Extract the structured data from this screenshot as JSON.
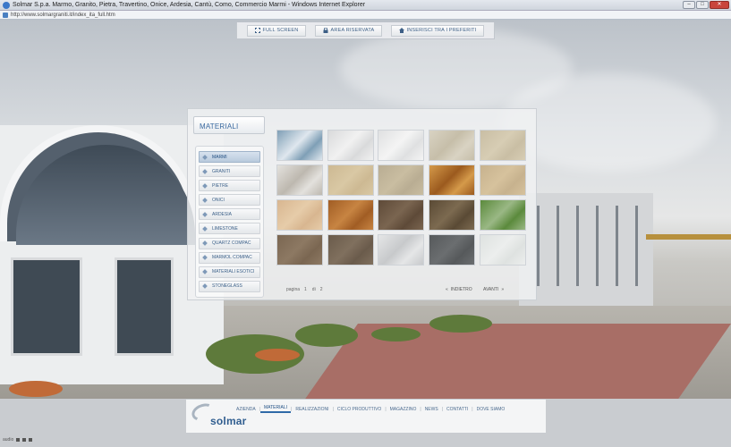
{
  "window": {
    "title": "Solmar S.p.a. Marmo, Granito, Pietra, Travertino, Onice, Ardesia, Cantù, Como, Commercio Marmi - Windows Internet Explorer",
    "url": "http://www.solmargraniti.it/index_ita_full.htm"
  },
  "toolbar": {
    "buttons": [
      {
        "label": "FULL SCREEN",
        "icon": "fullscreen-icon"
      },
      {
        "label": "AREA RISERVATA",
        "icon": "lock-icon"
      },
      {
        "label": "INSERISCI TRA I PREFERITI",
        "icon": "home-icon"
      }
    ]
  },
  "materials": {
    "title": "MATERIALI",
    "menu": [
      {
        "label": "MARMI",
        "active": true
      },
      {
        "label": "GRANITI",
        "active": false
      },
      {
        "label": "PIETRE",
        "active": false
      },
      {
        "label": "ONICI",
        "active": false
      },
      {
        "label": "ARDESIA",
        "active": false
      },
      {
        "label": "LIMESTONE",
        "active": false
      },
      {
        "label": "QUARTZ COMPAC",
        "active": false
      },
      {
        "label": "MARMOL COMPAC",
        "active": false
      },
      {
        "label": "MATERIALI ESOTICI",
        "active": false
      },
      {
        "label": "STONEGLASS",
        "active": false
      }
    ],
    "tiles": [
      {
        "color": "#7f9fb6",
        "accent": "#dfe7ee"
      },
      {
        "color": "#d9dadb",
        "accent": "#f1f1f1"
      },
      {
        "color": "#dfe0e1",
        "accent": "#f4f4f4"
      },
      {
        "color": "#d9d3c3",
        "accent": "#c6bea9"
      },
      {
        "color": "#c9bea4",
        "accent": "#d7cdb4"
      },
      {
        "color": "#e3e1dd",
        "accent": "#bdb8af"
      },
      {
        "color": "#cdb993",
        "accent": "#d9c8a4"
      },
      {
        "color": "#b9ad93",
        "accent": "#c9bda1"
      },
      {
        "color": "#d59a4a",
        "accent": "#9b5a1e"
      },
      {
        "color": "#c7b28e",
        "accent": "#d6c29d"
      },
      {
        "color": "#d8b690",
        "accent": "#e6cca9"
      },
      {
        "color": "#a15d24",
        "accent": "#c78442"
      },
      {
        "color": "#5e4a38",
        "accent": "#7a6550"
      },
      {
        "color": "#5a4a35",
        "accent": "#7c6a50"
      },
      {
        "color": "#5b8a3c",
        "accent": "#9ab885"
      },
      {
        "color": "#7a6651",
        "accent": "#8d7963"
      },
      {
        "color": "#6a5b4b",
        "accent": "#80705e"
      },
      {
        "color": "#e5e6e7",
        "accent": "#c7c9cb"
      },
      {
        "color": "#56595b",
        "accent": "#6b6e70"
      },
      {
        "color": "#dee2e0",
        "accent": "#eceeed"
      }
    ],
    "pager": {
      "label": "pagina",
      "current": "1",
      "of": "di",
      "total": "2",
      "prev": "INDIETRO",
      "next": "AVANTI",
      "prev_arrows": "«",
      "next_arrows": "»"
    }
  },
  "footer": {
    "logo": "solmar",
    "links": [
      {
        "label": "AZIENDA",
        "active": false
      },
      {
        "label": "MATERIALI",
        "active": true
      },
      {
        "label": "REALIZZAZIONI",
        "active": false
      },
      {
        "label": "CICLO PRODUTTIVO",
        "active": false
      },
      {
        "label": "MAGAZZINO",
        "active": false
      },
      {
        "label": "NEWS",
        "active": false
      },
      {
        "label": "CONTATTI",
        "active": false
      },
      {
        "label": "DOVE SIAMO",
        "active": false
      }
    ],
    "separator": "|"
  },
  "audio": {
    "label": "audio"
  }
}
